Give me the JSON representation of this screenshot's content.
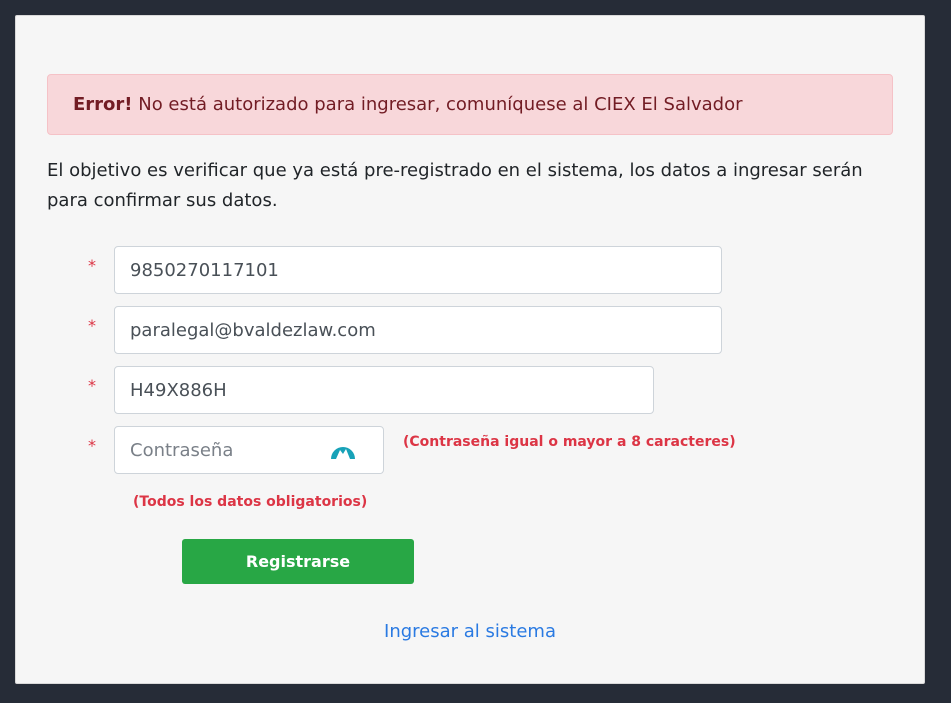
{
  "alert": {
    "label": "Error!",
    "message": " No está autorizado para ingresar, comuníquese al CIEX El Salvador"
  },
  "intro": "El objetivo es verificar que ya está pre-registrado en el sistema, los datos a ingresar serán para confirmar sus datos.",
  "required_marker": "*",
  "form": {
    "field1_value": "9850270117101",
    "email_value": "paralegal@bvaldezlaw.com",
    "field3_value": "H49X886H",
    "password_placeholder": "Contraseña",
    "password_hint": "(Contraseña igual o mayor a 8 caracteres)",
    "all_required_note": "(Todos los datos obligatorios)",
    "submit_label": "Registrarse",
    "login_link": "Ingresar al sistema"
  },
  "icons": {
    "password_manager": "password-manager-icon"
  },
  "colors": {
    "alert_bg": "#f8d7da",
    "alert_text": "#721c24",
    "required": "#dc3545",
    "button": "#28a745",
    "link": "#2a7ae2",
    "icon_teal": "#17a2b8"
  }
}
